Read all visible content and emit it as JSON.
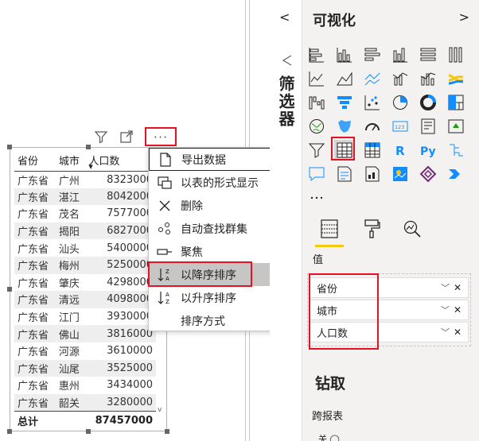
{
  "table": {
    "headers": [
      "省份",
      "城市",
      "人口数"
    ],
    "rows": [
      [
        "广东省",
        "广州",
        "8323000"
      ],
      [
        "广东省",
        "湛江",
        "8042000"
      ],
      [
        "广东省",
        "茂名",
        "7577000"
      ],
      [
        "广东省",
        "揭阳",
        "6827000"
      ],
      [
        "广东省",
        "汕头",
        "5400000"
      ],
      [
        "广东省",
        "梅州",
        "5250000"
      ],
      [
        "广东省",
        "肇庆",
        "4298000"
      ],
      [
        "广东省",
        "清远",
        "4098000"
      ],
      [
        "广东省",
        "江门",
        "3930000"
      ],
      [
        "广东省",
        "佛山",
        "3816000"
      ],
      [
        "广东省",
        "河源",
        "3610000"
      ],
      [
        "广东省",
        "汕尾",
        "3525000"
      ],
      [
        "广东省",
        "惠州",
        "3434000"
      ],
      [
        "广东省",
        "韶关",
        "3280000"
      ]
    ],
    "total_label": "总计",
    "total_value": "87457000"
  },
  "visual_header": {
    "more_glyph": "···"
  },
  "context_menu": {
    "items": [
      {
        "label": "导出数据",
        "icon": "export-icon"
      },
      {
        "label": "以表的形式显示",
        "icon": "table-view-icon"
      },
      {
        "label": "删除",
        "icon": "close-icon"
      },
      {
        "label": "自动查找群集",
        "icon": "cluster-icon"
      },
      {
        "label": "聚焦",
        "icon": "focus-mode-icon"
      },
      {
        "label": "以降序排序",
        "icon": "sort-descending-icon"
      },
      {
        "label": "以升序排序",
        "icon": "sort-ascending-icon"
      },
      {
        "label": "排序方式",
        "icon": "",
        "submenu": true
      }
    ]
  },
  "filters_pane": {
    "title": "筛选器",
    "collapse_glyph": "<"
  },
  "viz_pane": {
    "title": "可视化",
    "expand_glyph": ">",
    "values_label": "值",
    "fields": [
      "省份",
      "城市",
      "人口数"
    ],
    "drill_title": "钻取",
    "cross_report": "跨报表",
    "toggle_peek": "关",
    "more_glyph": "···",
    "r_label": "R",
    "py_label": "Py",
    "number_label": "123"
  },
  "colors": {
    "highlight_red": "#e81123",
    "accent_yellow": "#f2c811",
    "pane_bg": "#f3f2f1"
  }
}
